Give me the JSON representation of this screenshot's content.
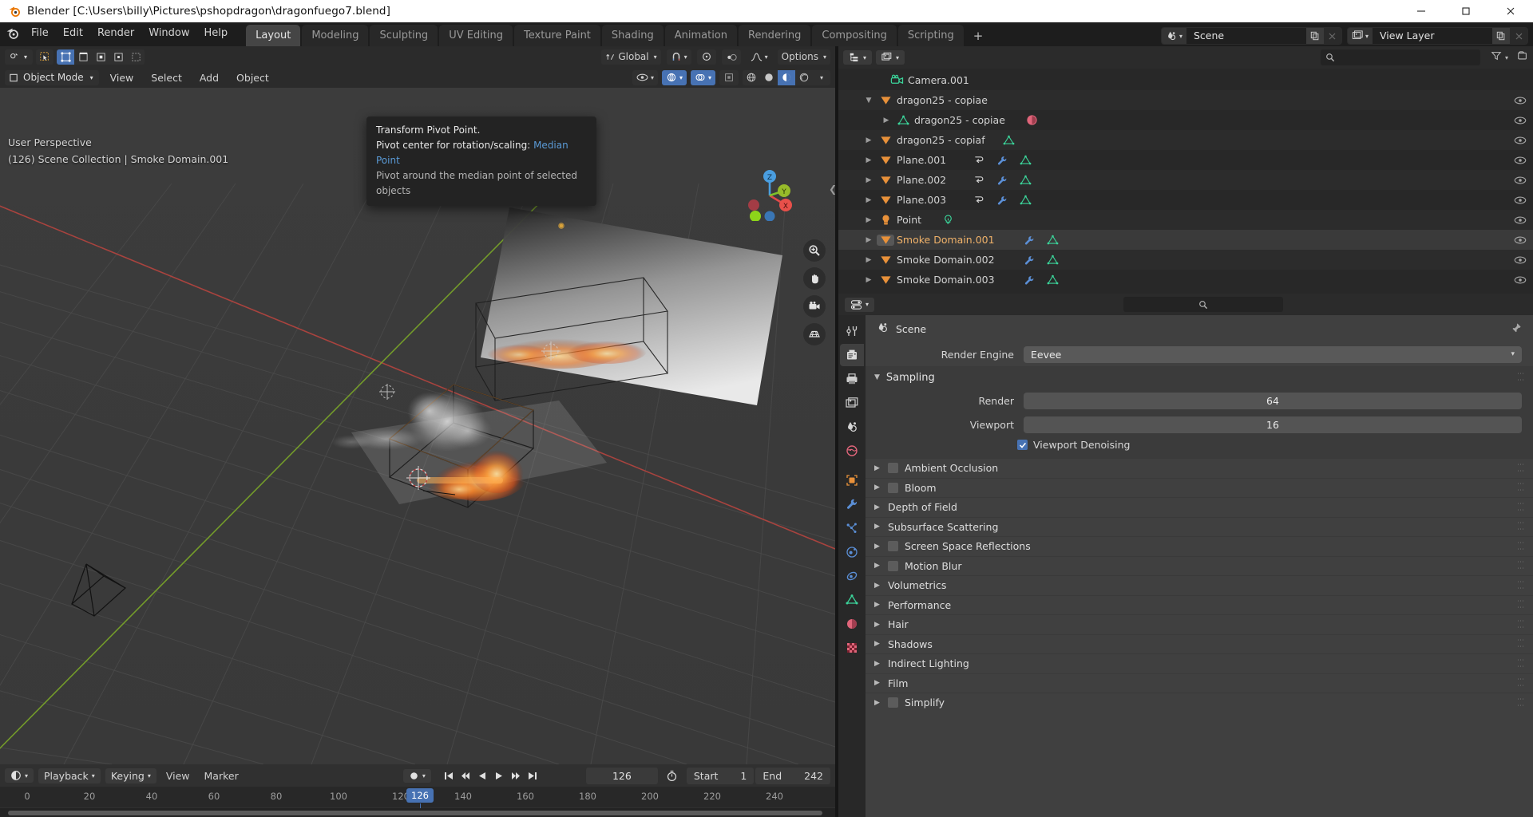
{
  "window": {
    "title": "Blender [C:\\Users\\billy\\Pictures\\pshopdragon\\dragonfuego7.blend]",
    "minimize": "–",
    "maximize": "❐",
    "close": "✕"
  },
  "topbar": {
    "menus": [
      "File",
      "Edit",
      "Render",
      "Window",
      "Help"
    ],
    "workspaces": [
      {
        "label": "Layout",
        "active": true
      },
      {
        "label": "Modeling",
        "active": false
      },
      {
        "label": "Sculpting",
        "active": false
      },
      {
        "label": "UV Editing",
        "active": false
      },
      {
        "label": "Texture Paint",
        "active": false
      },
      {
        "label": "Shading",
        "active": false
      },
      {
        "label": "Animation",
        "active": false
      },
      {
        "label": "Rendering",
        "active": false
      },
      {
        "label": "Compositing",
        "active": false
      },
      {
        "label": "Scripting",
        "active": false
      }
    ],
    "add_workspace": "+",
    "scene_name": "Scene",
    "view_layer_name": "View Layer"
  },
  "viewport": {
    "mode": "Object Mode",
    "menus": [
      "View",
      "Select",
      "Add",
      "Object"
    ],
    "transform_orientation": "Global",
    "options_label": "Options",
    "overlay_text_line1": "User Perspective",
    "overlay_text_line2": "(126) Scene Collection | Smoke Domain.001",
    "gizmo_axes": {
      "x": "X",
      "y": "Y",
      "z": "Z"
    }
  },
  "tooltip": {
    "title": "Transform Pivot Point.",
    "line2_label": "Pivot center for rotation/scaling:",
    "line2_value": "Median Point",
    "line3": "Pivot around the median point of selected objects"
  },
  "outliner": {
    "search_placeholder": "",
    "rows": [
      {
        "name": "Camera.001",
        "indent": 2,
        "disclosure": "",
        "icon": "camera-icon",
        "icon_color": "#3bd49a",
        "badges": [],
        "selected": false
      },
      {
        "name": "dragon25 - copiae",
        "indent": 1,
        "disclosure": "▼",
        "icon": "collection-icon",
        "icon_color": "#e8913a",
        "badges": [],
        "selected": false
      },
      {
        "name": "dragon25 - copiae",
        "indent": 2,
        "disclosure": "▶",
        "icon": "mesh-data-icon",
        "icon_color": "#3bd49a",
        "badges": [
          "material-icon"
        ],
        "selected": false
      },
      {
        "name": "dragon25 - copiaf",
        "indent": 1,
        "disclosure": "▶",
        "icon": "collection-icon",
        "icon_color": "#e8913a",
        "badges": [
          "mesh-data-icon"
        ],
        "selected": false
      },
      {
        "name": "Plane.001",
        "indent": 1,
        "disclosure": "▶",
        "icon": "collection-icon",
        "icon_color": "#e8913a",
        "badges": [
          "physics-icon",
          "modifier-icon",
          "mesh-data-icon"
        ],
        "selected": false
      },
      {
        "name": "Plane.002",
        "indent": 1,
        "disclosure": "▶",
        "icon": "collection-icon",
        "icon_color": "#e8913a",
        "badges": [
          "physics-icon",
          "modifier-icon",
          "mesh-data-icon"
        ],
        "selected": false
      },
      {
        "name": "Plane.003",
        "indent": 1,
        "disclosure": "▶",
        "icon": "collection-icon",
        "icon_color": "#e8913a",
        "badges": [
          "physics-icon",
          "modifier-icon",
          "mesh-data-icon"
        ],
        "selected": false
      },
      {
        "name": "Point",
        "indent": 1,
        "disclosure": "▶",
        "icon": "light-icon",
        "icon_color": "#e8913a",
        "badges": [
          "light-data-icon"
        ],
        "selected": false
      },
      {
        "name": "Smoke Domain.001",
        "indent": 1,
        "disclosure": "▶",
        "icon": "collection-icon",
        "icon_color": "#e8913a",
        "badges": [
          "modifier-icon",
          "mesh-data-icon"
        ],
        "selected": true
      },
      {
        "name": "Smoke Domain.002",
        "indent": 1,
        "disclosure": "▶",
        "icon": "collection-icon",
        "icon_color": "#e8913a",
        "badges": [
          "modifier-icon",
          "mesh-data-icon"
        ],
        "selected": false
      },
      {
        "name": "Smoke Domain.003",
        "indent": 1,
        "disclosure": "▶",
        "icon": "collection-icon",
        "icon_color": "#e8913a",
        "badges": [
          "modifier-icon",
          "mesh-data-icon"
        ],
        "selected": false
      }
    ]
  },
  "properties": {
    "breadcrumb": "Scene",
    "render_engine_label": "Render Engine",
    "render_engine_value": "Eevee",
    "sampling": {
      "title": "Sampling",
      "render_label": "Render",
      "render_value": "64",
      "viewport_label": "Viewport",
      "viewport_value": "16",
      "denoising_label": "Viewport Denoising",
      "denoising_checked": true
    },
    "sections": [
      {
        "label": "Ambient Occlusion",
        "has_checkbox": true,
        "checked": false
      },
      {
        "label": "Bloom",
        "has_checkbox": true,
        "checked": false
      },
      {
        "label": "Depth of Field",
        "has_checkbox": false,
        "checked": false
      },
      {
        "label": "Subsurface Scattering",
        "has_checkbox": false,
        "checked": false
      },
      {
        "label": "Screen Space Reflections",
        "has_checkbox": true,
        "checked": false
      },
      {
        "label": "Motion Blur",
        "has_checkbox": true,
        "checked": false
      },
      {
        "label": "Volumetrics",
        "has_checkbox": false,
        "checked": false
      },
      {
        "label": "Performance",
        "has_checkbox": false,
        "checked": false
      },
      {
        "label": "Hair",
        "has_checkbox": false,
        "checked": false
      },
      {
        "label": "Shadows",
        "has_checkbox": false,
        "checked": false
      },
      {
        "label": "Indirect Lighting",
        "has_checkbox": false,
        "checked": false
      },
      {
        "label": "Film",
        "has_checkbox": false,
        "checked": false
      },
      {
        "label": "Simplify",
        "has_checkbox": true,
        "checked": false
      }
    ]
  },
  "timeline": {
    "playback_label": "Playback",
    "keying_label": "Keying",
    "view_label": "View",
    "marker_label": "Marker",
    "current_frame": "126",
    "start_label": "Start",
    "start_value": "1",
    "end_label": "End",
    "end_value": "242",
    "ticks": [
      "0",
      "20",
      "40",
      "60",
      "80",
      "100",
      "120",
      "140",
      "160",
      "180",
      "200",
      "220",
      "240"
    ],
    "playhead_label": "126"
  }
}
